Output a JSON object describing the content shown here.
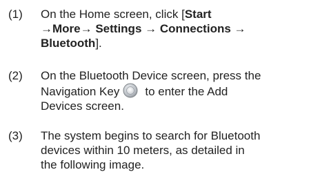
{
  "steps": [
    {
      "number": "(1)",
      "line1_prefix": "On the Home screen, click [",
      "line1_bold": "Start",
      "line2_bold": "→More→ Settings → Connections →",
      "line3_bold": "Bluetooth",
      "line3_suffix": "]."
    },
    {
      "number": "(2)",
      "line1": "On the Bluetooth Device screen, press the",
      "line2_before_icon": "Navigation Key",
      "icon": "navigation-key-icon",
      "line2_after_icon": "to enter the Add",
      "line3": "Devices screen."
    },
    {
      "number": "(3)",
      "line1": "The system begins to search for Bluetooth",
      "line2": "devices within 10 meters, as detailed in",
      "line3": "the following image."
    }
  ]
}
